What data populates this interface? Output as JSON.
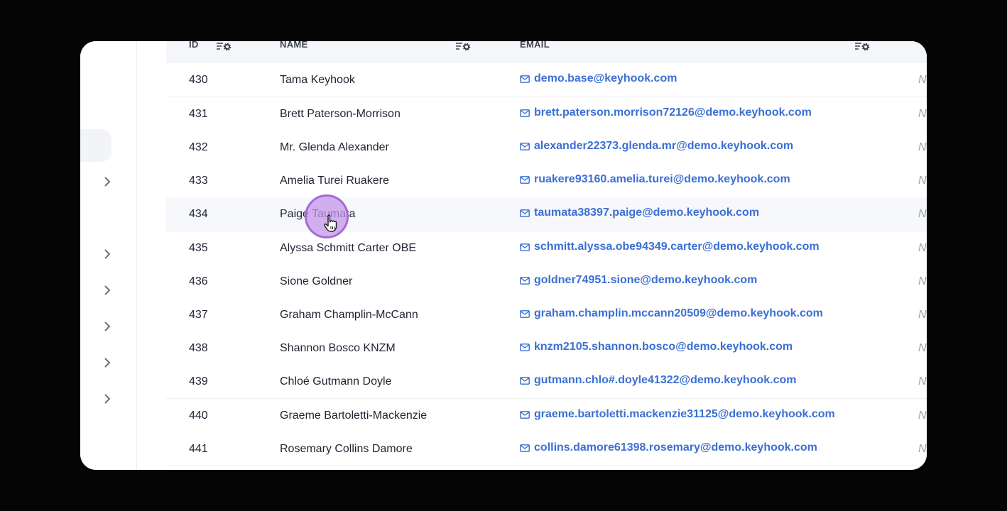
{
  "table": {
    "headers": {
      "id": "ID",
      "name": "NAME",
      "email": "EMAIL"
    },
    "next_column_cell": "N",
    "rows": [
      {
        "id": "430",
        "name": "Tama Keyhook",
        "email": "demo.base@keyhook.com"
      },
      {
        "id": "431",
        "name": "Brett Paterson-Morrison",
        "email": "brett.paterson.morrison72126@demo.keyhook.com"
      },
      {
        "id": "432",
        "name": "Mr. Glenda Alexander",
        "email": "alexander22373.glenda.mr@demo.keyhook.com"
      },
      {
        "id": "433",
        "name": "Amelia Turei Ruakere",
        "email": "ruakere93160.amelia.turei@demo.keyhook.com"
      },
      {
        "id": "434",
        "name": "Paige Taumata",
        "email": "taumata38397.paige@demo.keyhook.com"
      },
      {
        "id": "435",
        "name": "Alyssa Schmitt Carter OBE",
        "email": "schmitt.alyssa.obe94349.carter@demo.keyhook.com"
      },
      {
        "id": "436",
        "name": "Sione Goldner",
        "email": "goldner74951.sione@demo.keyhook.com"
      },
      {
        "id": "437",
        "name": "Graham Champlin-McCann",
        "email": "graham.champlin.mccann20509@demo.keyhook.com"
      },
      {
        "id": "438",
        "name": "Shannon Bosco KNZM",
        "email": "knzm2105.shannon.bosco@demo.keyhook.com"
      },
      {
        "id": "439",
        "name": "Chloé Gutmann Doyle",
        "email": "gutmann.chlo#.doyle41322@demo.keyhook.com"
      },
      {
        "id": "440",
        "name": "Graeme Bartoletti-Mackenzie",
        "email": "graeme.bartoletti.mackenzie31125@demo.keyhook.com"
      },
      {
        "id": "441",
        "name": "Rosemary Collins Damore",
        "email": "collins.damore61398.rosemary@demo.keyhook.com"
      }
    ]
  },
  "colors": {
    "accent": "#3b6fd4",
    "cursor": "#a46bd6",
    "background": "#050505"
  },
  "icons": [
    "chevron-right-icon",
    "column-settings-icon",
    "mail-icon",
    "hand-pointer-icon"
  ]
}
